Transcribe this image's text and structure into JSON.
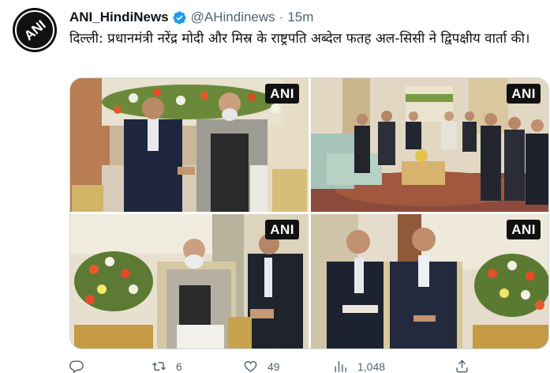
{
  "author": {
    "avatar_text": "ANI",
    "name": "ANI_HindiNews",
    "handle": "@AHindinews",
    "separator": "·",
    "time": "15m"
  },
  "tweet": {
    "text": "दिल्ली: प्रधानमंत्री नरेंद्र मोदी और मिस्र के राष्ट्रपति अब्देल फतह अल-सिसी ने द्विपक्षीय वार्ता की।"
  },
  "media": {
    "watermark": "ANI",
    "photos": [
      {
        "name": "photo-handshake"
      },
      {
        "name": "photo-delegation-room"
      },
      {
        "name": "photo-modi-seated"
      },
      {
        "name": "photo-sisi-seated"
      }
    ]
  },
  "actions": {
    "reply": {
      "icon": "reply-icon",
      "count": ""
    },
    "retweet": {
      "icon": "retweet-icon",
      "count": "6"
    },
    "like": {
      "icon": "heart-icon",
      "count": "49"
    },
    "views": {
      "icon": "views-icon",
      "count": "1,048"
    },
    "share": {
      "icon": "share-icon",
      "count": ""
    }
  },
  "colors": {
    "text": "#0f1419",
    "secondary": "#536471",
    "verified": "#1d9bf0",
    "border": "#cfd9de"
  }
}
